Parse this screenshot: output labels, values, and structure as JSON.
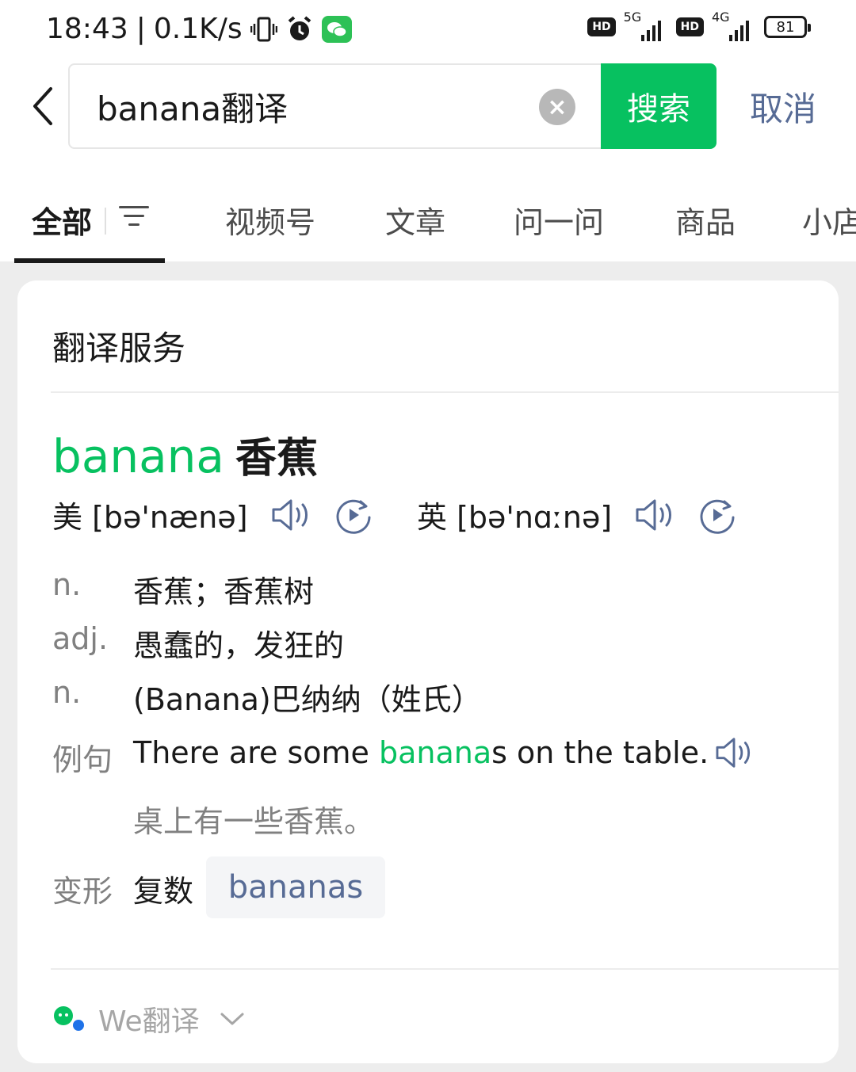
{
  "status_bar": {
    "time": "18:43",
    "separator": "|",
    "net_speed": "0.1K/s",
    "hd1": "HD",
    "net1": "5G",
    "hd2": "HD",
    "net2": "4G",
    "battery": "81"
  },
  "search": {
    "query": "banana翻译",
    "button_label": "搜索",
    "cancel_label": "取消"
  },
  "tabs": [
    {
      "label": "全部"
    },
    {
      "label": "视频号"
    },
    {
      "label": "文章"
    },
    {
      "label": "问一问"
    },
    {
      "label": "商品"
    },
    {
      "label": "小店"
    }
  ],
  "translation": {
    "section_title": "翻译服务",
    "word": "banana",
    "word_translation": "香蕉",
    "us_phonetic": "美 [bə'nænə]",
    "uk_phonetic": "英 [bə'nɑːnə]",
    "definitions": [
      {
        "pos": "n.",
        "meaning": "香蕉；香蕉树"
      },
      {
        "pos": "adj.",
        "meaning": "愚蠢的，发狂的"
      },
      {
        "pos": "n.",
        "meaning": "(Banana)巴纳纳（姓氏）"
      }
    ],
    "example_label": "例句",
    "example_before": "There are some ",
    "example_highlight": "banana",
    "example_after": "s on the table.",
    "example_translation": "桌上有一些香蕉。",
    "forms_label": "变形",
    "plural_label": "复数",
    "plural_word": "bananas",
    "footer_label": "We翻译"
  },
  "colors": {
    "accent_green": "#07c160",
    "link_blue": "#576b95"
  }
}
